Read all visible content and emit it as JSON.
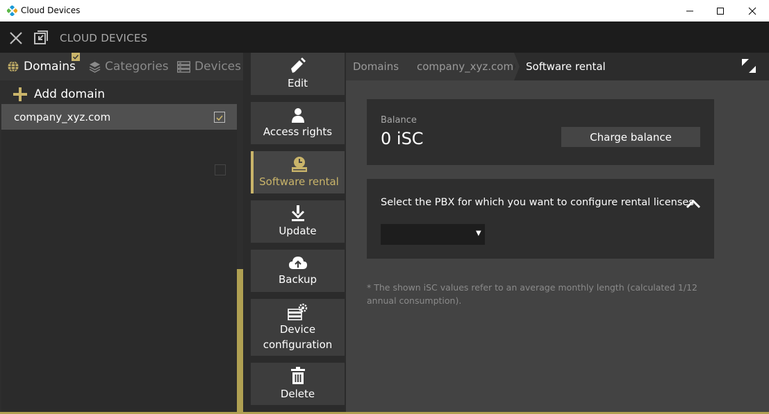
{
  "window": {
    "title": "Cloud Devices",
    "controls": [
      "minimize-icon",
      "maximize-icon",
      "close-icon"
    ]
  },
  "app_header": {
    "title": "CLOUD DEVICES",
    "icons": [
      "close-icon",
      "restore-window-icon"
    ]
  },
  "left_panel": {
    "tabs": [
      {
        "label": "Domains",
        "icon": "globe-icon",
        "active": true
      },
      {
        "label": "Categories",
        "icon": "layers-icon",
        "active": false
      },
      {
        "label": "Devices",
        "icon": "server-icon",
        "active": false
      }
    ],
    "add_label": "Add domain",
    "domains": [
      {
        "name": "company_xyz.com",
        "checked": true
      }
    ]
  },
  "actions": [
    {
      "label": "Edit",
      "icon": "pencil-icon",
      "active": false
    },
    {
      "label": "Access rights",
      "icon": "user-icon",
      "active": false
    },
    {
      "label": "Software rental",
      "icon": "rental-icon",
      "active": true
    },
    {
      "label": "Update",
      "icon": "download-icon",
      "active": false
    },
    {
      "label": "Backup",
      "icon": "cloud-upload-icon",
      "active": false
    },
    {
      "label": "Device configuration",
      "label_lines": [
        "Device",
        "configuration"
      ],
      "icon": "device-config-icon",
      "active": false
    },
    {
      "label": "Delete",
      "icon": "trash-icon",
      "active": false
    }
  ],
  "breadcrumb": [
    "Domains",
    "company_xyz.com",
    "Software rental"
  ],
  "balance": {
    "label": "Balance",
    "value": "0 iSC",
    "button": "Charge balance"
  },
  "pbx": {
    "prompt": "Select the PBX for which you want to configure rental licenses",
    "selected": ""
  },
  "footnote": "* The shown iSC values refer to an average monthly length (calculated 1/12 annual consumption).",
  "colors": {
    "accent": "#c9b46a",
    "titlebar": "#ffffff",
    "appbar": "#1c1c1c",
    "background": "#434343",
    "card": "#2e2e2e"
  }
}
